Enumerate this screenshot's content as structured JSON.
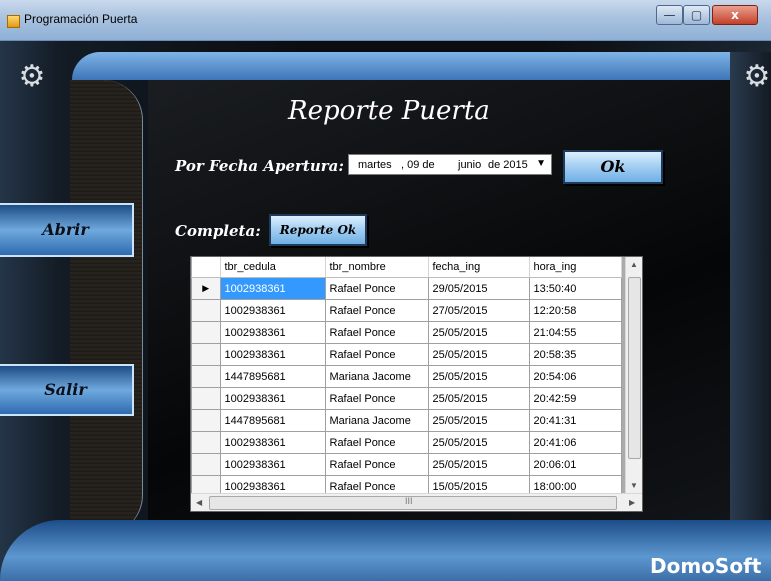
{
  "window": {
    "title": "Programación Puerta",
    "minimize": "—",
    "maximize": "▢",
    "close": "x"
  },
  "heading": "Reporte Puerta",
  "filter": {
    "label": "Por Fecha Apertura:",
    "date_weekday": "martes",
    "date_day": ", 09 de",
    "date_month": "junio",
    "date_year": "de 2015",
    "ok_button": "Ok"
  },
  "complete": {
    "label": "Completa:",
    "report_button": "Reporte Ok"
  },
  "sidebar": {
    "open_button": "Abrir",
    "exit_button": "Salir"
  },
  "grid": {
    "columns": [
      "tbr_cedula",
      "tbr_nombre",
      "fecha_ing",
      "hora_ing"
    ],
    "rows": [
      [
        "1002938361",
        "Rafael Ponce",
        "29/05/2015",
        "13:50:40"
      ],
      [
        "1002938361",
        "Rafael Ponce",
        "27/05/2015",
        "12:20:58"
      ],
      [
        "1002938361",
        "Rafael Ponce",
        "25/05/2015",
        "21:04:55"
      ],
      [
        "1002938361",
        "Rafael Ponce",
        "25/05/2015",
        "20:58:35"
      ],
      [
        "1447895681",
        "Mariana Jacome",
        "25/05/2015",
        "20:54:06"
      ],
      [
        "1002938361",
        "Rafael Ponce",
        "25/05/2015",
        "20:42:59"
      ],
      [
        "1447895681",
        "Mariana Jacome",
        "25/05/2015",
        "20:41:31"
      ],
      [
        "1002938361",
        "Rafael Ponce",
        "25/05/2015",
        "20:41:06"
      ],
      [
        "1002938361",
        "Rafael Ponce",
        "25/05/2015",
        "20:06:01"
      ],
      [
        "1002938361",
        "Rafael Ponce",
        "15/05/2015",
        "18:00:00"
      ]
    ],
    "row_indicator": "▶",
    "hscroll_mark": "III"
  },
  "brand": "DomoSoft",
  "icons": {
    "gear_left": "gear-icon",
    "gear_right": "gear-icon",
    "dropdown": "chevron-down-icon"
  },
  "colors": {
    "selected_cell": "#3399ff",
    "button_accent": "#6fb0e5"
  }
}
